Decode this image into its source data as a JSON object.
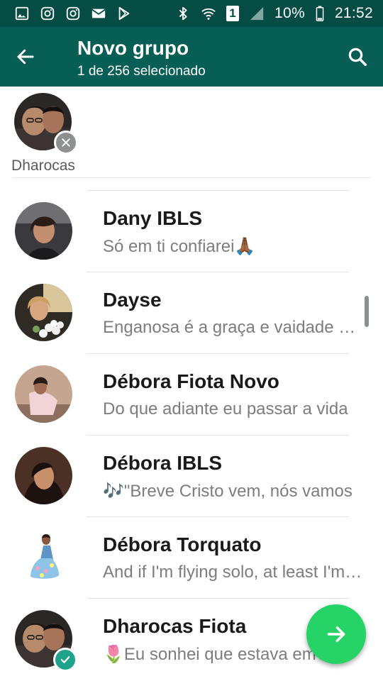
{
  "status_bar": {
    "battery": "10%",
    "time": "21:52",
    "sim": "1",
    "left_icons": [
      "gallery-icon",
      "instagram-icon",
      "instagram-icon",
      "mail-icon",
      "play-store-icon"
    ],
    "right_icons": [
      "bluetooth-icon",
      "wifi-icon",
      "sim-icon",
      "signal-icon",
      "battery-icon"
    ]
  },
  "toolbar": {
    "title": "Novo grupo",
    "subtitle": "1 de 256 selecionado",
    "back_icon": "arrow-left-icon",
    "search_icon": "search-icon"
  },
  "selected": [
    {
      "name": "Dharocas",
      "remove_icon": "close-icon"
    }
  ],
  "contacts": [
    {
      "name": "Dany IBLS",
      "status": "Só em ti confiarei🙏🏾",
      "selected": false
    },
    {
      "name": "Dayse",
      "status": "Enganosa é a graça e vaidade é a beleza",
      "selected": false
    },
    {
      "name": "Débora Fiota Novo",
      "status": "Do que adiante eu passar a vida",
      "selected": false
    },
    {
      "name": "Débora IBLS",
      "status": "🎶\"Breve Cristo vem, nós vamos",
      "selected": false
    },
    {
      "name": "Débora Torquato",
      "status": "And if I'm flying solo, at least I'm flying free",
      "selected": false
    },
    {
      "name": "Dharocas Fiota",
      "status": "🌷Eu sonhei que estava em",
      "selected": true
    }
  ],
  "fab": {
    "icon": "arrow-right-icon"
  },
  "colors": {
    "status_bar": "#054d44",
    "toolbar": "#075e54",
    "fab": "#25d366",
    "check": "#1fa38a",
    "remove": "#8e9092"
  }
}
